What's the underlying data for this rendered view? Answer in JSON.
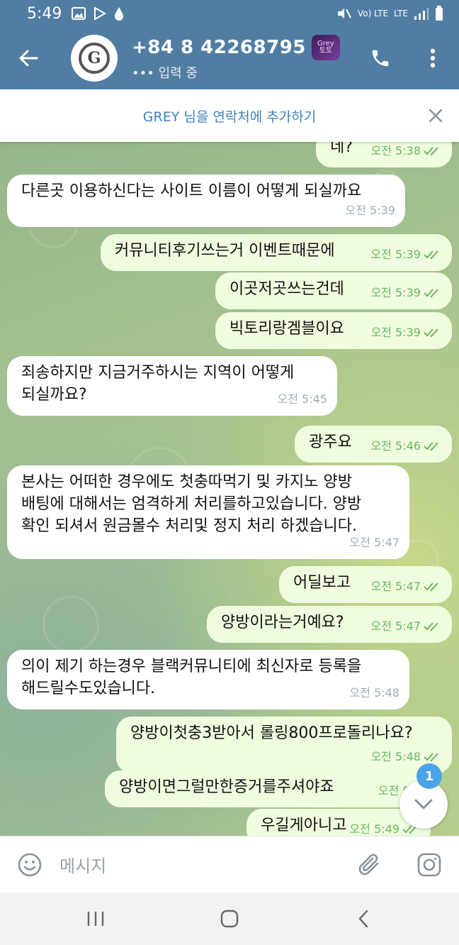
{
  "status_bar": {
    "time": "5:49",
    "network": "LTE",
    "volte": "Vo) LTE"
  },
  "header": {
    "title": "+84 8 42268795",
    "badge_text": "Grey 토토사이트",
    "subtitle": "••• 입력 중"
  },
  "add_contact_bar": {
    "label": "GREY 님을 연락처에 추가하기"
  },
  "messages": [
    {
      "dir": "out",
      "text": "네?",
      "time": "오전 5:38"
    },
    {
      "dir": "in",
      "text": "다른곳 이용하신다는 사이트 이름이 어떻게 되실까요",
      "time": "오전 5:39"
    },
    {
      "dir": "out",
      "text": "커뮤니티후기쓰는거 이벤트때문에",
      "time": "오전 5:39"
    },
    {
      "dir": "out",
      "text": "이곳저곳쓰는건데",
      "time": "오전 5:39"
    },
    {
      "dir": "out",
      "text": "빅토리랑겜블이요",
      "time": "오전 5:39"
    },
    {
      "dir": "in",
      "line1": "죄송하지만 지금거주하시는 지역이 어떻게",
      "line2": "되실까요?",
      "time": "오전 5:45"
    },
    {
      "dir": "out",
      "text": "광주요",
      "time": "오전 5:46"
    },
    {
      "dir": "in",
      "line1": "본사는 어떠한 경우에도 첫충따먹기 및 카지노 양방",
      "line2": "배팅에 대해서는 엄격하게 처리를하고있습니다. 양방",
      "line3": "확인 되셔서 원금몰수 처리및 정지 처리 하겠습니다.",
      "time": "오전 5:47"
    },
    {
      "dir": "out",
      "text": "어딜보고",
      "time": "오전 5:47"
    },
    {
      "dir": "out",
      "text": "양방이라는거예요?",
      "time": "오전 5:47"
    },
    {
      "dir": "in",
      "line1": "의이 제기 하는경우 블랙커뮤니티에 최신자로 등록을",
      "line2": "해드릴수도있습니다.",
      "time": "오전 5:48"
    },
    {
      "dir": "out",
      "text": "양방이첫충3받아서 롤링800프로돌리나요?",
      "time": "오전 5:48"
    },
    {
      "dir": "out",
      "text": "양방이면그럴만한증거를주셔야죠",
      "time": "오전 5:4"
    },
    {
      "dir": "out",
      "text": "우길게아니고",
      "time": "오전 5:49"
    }
  ],
  "unread_count": "1",
  "input": {
    "placeholder": "메시지"
  },
  "colors": {
    "header": "#517da2",
    "out_bubble": "#effdde",
    "in_bubble": "#ffffff",
    "accent": "#3d82bd",
    "check": "#6cb565"
  },
  "icons": [
    "back-arrow-icon",
    "phone-icon",
    "more-vert-icon",
    "close-icon",
    "emoji-icon",
    "attach-icon",
    "camera-icon",
    "chevron-down-icon",
    "double-check-icon"
  ]
}
